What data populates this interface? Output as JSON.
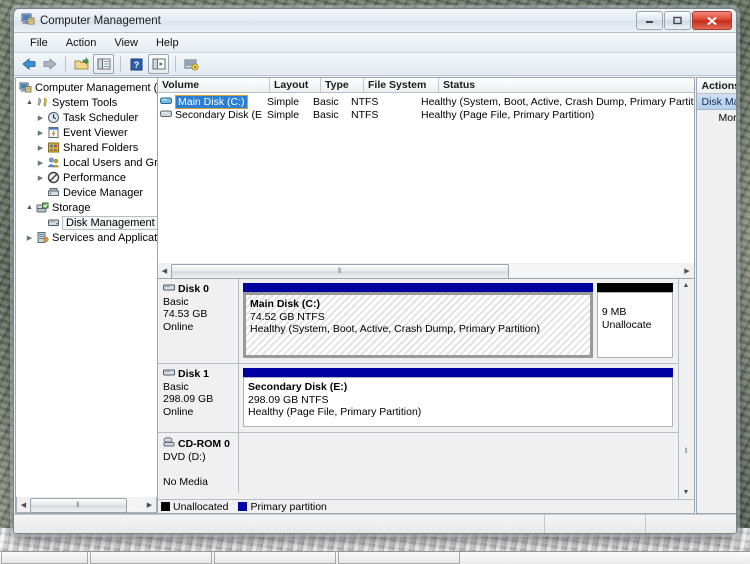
{
  "window": {
    "title": "Computer Management",
    "app_icon": "computer-management-icon",
    "buttons": {
      "minimize": "–",
      "maximize": "□",
      "close": "✕"
    }
  },
  "menubar": {
    "items": [
      "File",
      "Action",
      "View",
      "Help"
    ]
  },
  "toolbar": {
    "items": [
      {
        "name": "back-icon",
        "glyph": "←"
      },
      {
        "name": "forward-icon",
        "glyph": "→"
      },
      {
        "name": "up-folder-icon",
        "glyph": "↰"
      },
      {
        "name": "show-hide-console-tree-icon",
        "glyph": "▤"
      },
      {
        "name": "help-icon",
        "glyph": "?"
      },
      {
        "name": "properties-icon",
        "glyph": "▤"
      },
      {
        "name": "rescan-disks-icon",
        "glyph": "⚙"
      }
    ]
  },
  "tree": {
    "root": {
      "label": "Computer Management (Local",
      "icon": "computer-icon"
    },
    "items": [
      {
        "label": "System Tools",
        "icon": "system-tools-icon",
        "twisty": "open",
        "indent": 1
      },
      {
        "label": "Task Scheduler",
        "icon": "clock-icon",
        "twisty": "closed",
        "indent": 2
      },
      {
        "label": "Event Viewer",
        "icon": "event-viewer-icon",
        "twisty": "closed",
        "indent": 2
      },
      {
        "label": "Shared Folders",
        "icon": "shared-folders-icon",
        "twisty": "closed",
        "indent": 2
      },
      {
        "label": "Local Users and Groups",
        "icon": "users-icon",
        "twisty": "closed",
        "indent": 2
      },
      {
        "label": "Performance",
        "icon": "performance-icon",
        "twisty": "closed",
        "indent": 2
      },
      {
        "label": "Device Manager",
        "icon": "device-manager-icon",
        "twisty": "none",
        "indent": 2
      },
      {
        "label": "Storage",
        "icon": "storage-icon",
        "twisty": "open",
        "indent": 1
      },
      {
        "label": "Disk Management",
        "icon": "disk-management-icon",
        "twisty": "none",
        "indent": 2,
        "selected": true
      },
      {
        "label": "Services and Applications",
        "icon": "services-icon",
        "twisty": "closed",
        "indent": 1
      }
    ]
  },
  "volume_list": {
    "columns": [
      "Volume",
      "Layout",
      "Type",
      "File System",
      "Status"
    ],
    "rows": [
      {
        "volume": "Main Disk (C:)",
        "layout": "Simple",
        "type": "Basic",
        "file_system": "NTFS",
        "status": "Healthy (System, Boot, Active, Crash Dump, Primary Partit",
        "selected": true,
        "icon": "volume-icon"
      },
      {
        "volume": "Secondary Disk (E:)",
        "layout": "Simple",
        "type": "Basic",
        "file_system": "NTFS",
        "status": "Healthy (Page File, Primary Partition)",
        "selected": false,
        "icon": "volume-icon"
      }
    ]
  },
  "graphical_view": {
    "disks": [
      {
        "name": "Disk 0",
        "icon": "disk-icon",
        "type": "Basic",
        "capacity": "74.53 GB",
        "state": "Online",
        "partitions": [
          {
            "name": "Main Disk  (C:)",
            "size": "74.52 GB NTFS",
            "status": "Healthy (System, Boot, Active, Crash Dump, Primary Partition)",
            "cap_color": "#0000a0",
            "kind": "primary",
            "selected": true,
            "width_pct": 74
          },
          {
            "name": "",
            "size": "9 MB",
            "status": "Unallocate",
            "cap_color": "#000000",
            "kind": "unallocated",
            "selected": false,
            "width_pct": 16
          }
        ]
      },
      {
        "name": "Disk 1",
        "icon": "disk-icon",
        "type": "Basic",
        "capacity": "298.09 GB",
        "state": "Online",
        "partitions": [
          {
            "name": "Secondary Disk  (E:)",
            "size": "298.09 GB NTFS",
            "status": "Healthy (Page File, Primary Partition)",
            "cap_color": "#0000a0",
            "kind": "primary",
            "selected": false,
            "width_pct": 100
          }
        ]
      },
      {
        "name": "CD-ROM 0",
        "icon": "cdrom-icon",
        "type": "DVD (D:)",
        "capacity": "",
        "state": "No Media",
        "partitions": []
      }
    ],
    "legend": [
      {
        "label": "Unallocated",
        "color": "#000000"
      },
      {
        "label": "Primary partition",
        "color": "#0000a0"
      }
    ]
  },
  "actions": {
    "header": "Actions",
    "group": {
      "label": "Disk Management",
      "collapse_icon": "chevron-up-icon"
    },
    "items": [
      {
        "label": "More Actions",
        "submenu_icon": "chevron-right-icon"
      }
    ]
  },
  "scrollbars": {
    "left_arrow": "◀",
    "right_arrow": "▶",
    "up_arrow": "▲",
    "down_arrow": "▼",
    "grip": "‖"
  },
  "statusbar": {
    "text": ""
  }
}
